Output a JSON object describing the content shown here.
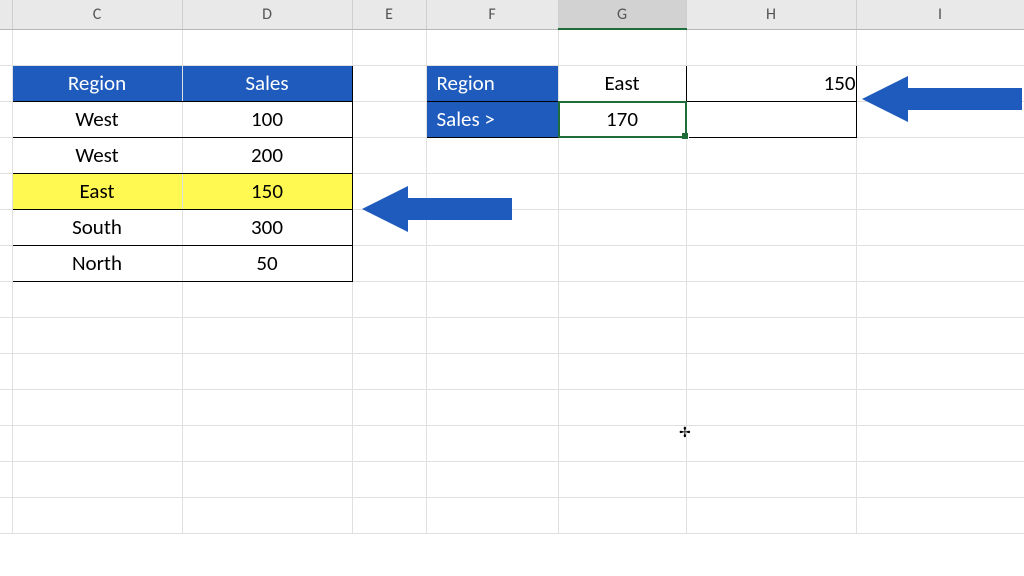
{
  "columns": [
    "C",
    "D",
    "E",
    "F",
    "G",
    "H",
    "I"
  ],
  "selected_column_index": 4,
  "left_table": {
    "headers": [
      "Region",
      "Sales"
    ],
    "rows": [
      {
        "region": "West",
        "sales": "100",
        "highlight": false
      },
      {
        "region": "West",
        "sales": "200",
        "highlight": false
      },
      {
        "region": "East",
        "sales": "150",
        "highlight": true
      },
      {
        "region": "South",
        "sales": "300",
        "highlight": false
      },
      {
        "region": "North",
        "sales": "50",
        "highlight": false
      }
    ]
  },
  "criteria": {
    "rows": [
      {
        "label": "Region",
        "value": "East"
      },
      {
        "label": "Sales >",
        "value": "170"
      }
    ]
  },
  "result_cell": "150",
  "active_cell_value": "170",
  "colors": {
    "header_bg": "#1f5bbd",
    "highlight_bg": "#fff952",
    "arrow": "#1f5bbd"
  }
}
